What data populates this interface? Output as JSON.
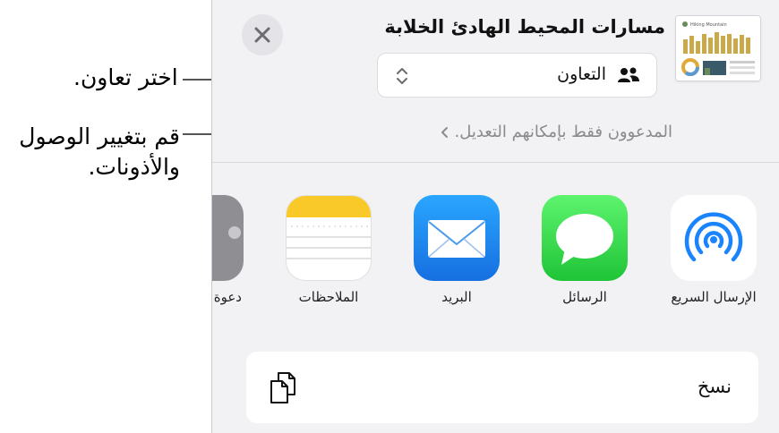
{
  "callouts": {
    "choose_collaborate": "اختر تعاون.",
    "change_access_line1": "قم بتغيير الوصول",
    "change_access_line2": "والأذونات."
  },
  "sheet": {
    "document_title": "مسارات المحيط الهادئ الخلابة",
    "thumbnail_caption": "Hiking Mountain",
    "collaboration_mode": "التعاون",
    "access_summary": "المدعوون فقط بإمكانهم التعديل."
  },
  "apps": [
    {
      "name": "airdrop",
      "label": "الإرسال السريع",
      "color": "#1a84ff"
    },
    {
      "name": "messages",
      "label": "الرسائل",
      "color": "#2fcf4f"
    },
    {
      "name": "mail",
      "label": "البريد",
      "color": "#1f8ef3"
    },
    {
      "name": "notes",
      "label": "الملاحظات",
      "color": "#f8c928"
    },
    {
      "name": "invite",
      "label": "دعوة",
      "color": "#8e8e93"
    }
  ],
  "actions": {
    "copy_label": "نسخ"
  },
  "icons": {
    "close": "close-icon",
    "people": "people-icon",
    "updown": "chevron-up-down-icon",
    "chevron": "chevron-right-icon",
    "copy": "copy-icon"
  }
}
